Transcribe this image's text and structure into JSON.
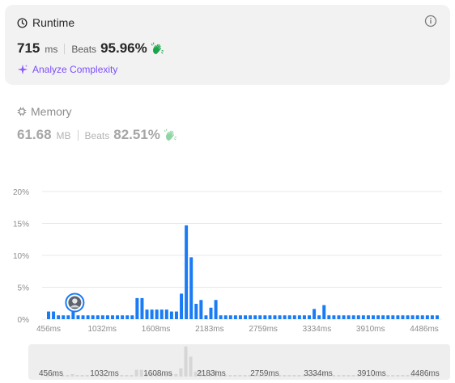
{
  "runtime": {
    "title": "Runtime",
    "value": "715",
    "unit": "ms",
    "beats_label": "Beats",
    "beats_value": "95.96%",
    "analyze_label": "Analyze Complexity"
  },
  "memory": {
    "title": "Memory",
    "value": "61.68",
    "unit": "MB",
    "beats_label": "Beats",
    "beats_value": "82.51%"
  },
  "colors": {
    "bar": "#1a7cf5",
    "accent_purple": "#7c4dff",
    "hand_green": "#1aa34a",
    "grid": "#e8e8e8"
  },
  "icons": {
    "runtime": "clock-icon",
    "memory": "chip-icon",
    "info": "info-icon",
    "analyze": "sparkle-icon",
    "beats": "clapping-hands-icon"
  },
  "chart_data": {
    "type": "bar",
    "ylim": [
      0,
      20
    ],
    "y_ticks": [
      "0%",
      "5%",
      "10%",
      "15%",
      "20%"
    ],
    "x_tick_labels": [
      "456ms",
      "1032ms",
      "1608ms",
      "2183ms",
      "2759ms",
      "3334ms",
      "3910ms",
      "4486ms"
    ],
    "bar_unit": "%",
    "values": [
      1.2,
      1.2,
      0.6,
      0.6,
      0.6,
      1.2,
      0.6,
      0.6,
      0.6,
      0.6,
      0.6,
      0.6,
      0.6,
      0.6,
      0.6,
      0.6,
      0.6,
      0.6,
      3.3,
      3.3,
      1.5,
      1.5,
      1.5,
      1.5,
      1.5,
      1.2,
      1.2,
      4.0,
      14.7,
      9.7,
      2.4,
      3.0,
      0.6,
      1.8,
      3.0,
      0.6,
      0.6,
      0.6,
      0.6,
      0.6,
      0.6,
      0.6,
      0.6,
      0.6,
      0.6,
      0.6,
      0.6,
      0.6,
      0.6,
      0.6,
      0.6,
      0.6,
      0.6,
      0.6,
      1.6,
      0.6,
      2.2,
      0.6,
      0.6,
      0.6,
      0.6,
      0.6,
      0.6,
      0.6,
      0.6,
      0.6,
      0.6,
      0.6,
      0.6,
      0.6,
      0.6,
      0.6,
      0.6,
      0.6,
      0.6,
      0.6,
      0.6,
      0.6,
      0.6,
      0.6
    ],
    "highlight_index": 5,
    "grid": true,
    "legend": "none"
  }
}
